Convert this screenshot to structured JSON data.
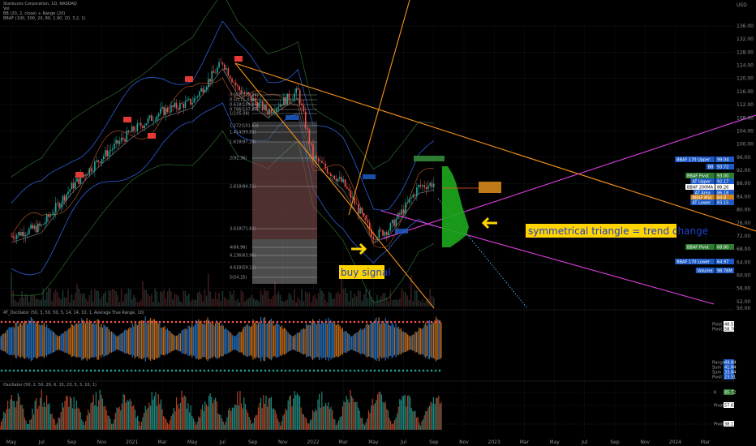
{
  "header": {
    "title": "Starbucks Corporation, 1D, NASDAQ",
    "line2": "Vol",
    "line3": "BB (20, 2, close) + Range (20)",
    "line4": "BBAF (100, 300, 20, 80, 1.90, 20, 3.2, 1)"
  },
  "price_axis": {
    "unit": "USD",
    "ticks": [
      "136.00",
      "132.00",
      "128.00",
      "124.00",
      "120.00",
      "116.00",
      "112.00",
      "108.00",
      "104.00",
      "100.00",
      "96.00",
      "92.00",
      "88.00",
      "84.00",
      "80.00",
      "76.00",
      "72.00",
      "68.00",
      "64.00",
      "60.00",
      "56.00",
      "52.00",
      "50.00"
    ]
  },
  "time_axis": {
    "ticks": [
      "May",
      "Jul",
      "Sep",
      "Nov",
      "2021",
      "Mar",
      "May",
      "Jul",
      "Sep",
      "Nov",
      "2022",
      "Mar",
      "May",
      "Jul",
      "Sep",
      "Nov",
      "2023",
      "Mar",
      "May",
      "Jul",
      "Sep",
      "Nov",
      "2024",
      "Mar"
    ]
  },
  "annotations": {
    "triangle": "symmetrical triangle = trend change",
    "buy": "buy signal"
  },
  "fib_levels": [
    "0.382(112.94)",
    "0.5(111.45)",
    "0.618(109.85)",
    "0.786(107.87)",
    "1(105.08)",
    "1.272(101.63)",
    "1.414(99.83)",
    "1.618(97.24)",
    "2(92.36)",
    "2.618(84.51)",
    "3.618(71.82)",
    "4(66.96)",
    "4.236(63.96)",
    "4.618(59.11)",
    "5(54.25)"
  ],
  "right_labels": {
    "bbaf_upper": "BBAF 170 Upper",
    "bb_upper": "BB Upper",
    "bb": "BB",
    "ema": "EMA",
    "bbaf_pivot": "BBAF Pivot",
    "at_upper": "AT Upper",
    "bbaf_200ma": "BBAF 200MA",
    "at_area": "AT Area",
    "bbaf_mid": "BBAF Mid",
    "at_lower": "AT Lower",
    "bbaf_pivot2": "BBAF Pivot",
    "bbaf_170_lower": "BBAF 170 Lower",
    "volume": "Volume",
    "at_value": "99.04",
    "bb_value": "93.72",
    "bb_val2": "93.00",
    "pivot_val": "92.17",
    "ma_val": "88.26",
    "area_val": "86.18",
    "mid_val": "84.8",
    "lower_val": "83.15",
    "pivot2_val": "68.80",
    "low_val": "64.97",
    "vol_val": "98.76M"
  },
  "panel2": {
    "title": "AT_Oscillator (50, 3, 50, 50, 5, 14, 14, 10, 1, Average True Range, 10)",
    "labels": [
      "Pivot",
      "Pivot",
      "Range",
      "Sum",
      "Sum",
      "Pivot"
    ],
    "values": [
      "48.51",
      "58.70",
      "49.84",
      "41.84",
      "33.84",
      "23.51"
    ]
  },
  "panel3": {
    "title": "Oscillator (50, 2, 50, 20, 6, 15, 23, 5, 3, 10, 1)",
    "values": [
      "85.72",
      "57.62",
      "38.13"
    ],
    "labels": [
      "K",
      "Pivot",
      "Pivot"
    ],
    "ticks": [
      "80.00",
      "40.00",
      "20.00"
    ]
  },
  "colors": {
    "orange": "#f7931a",
    "magenta": "#e040e0",
    "annotation_yellow": "#ffd400",
    "green_candle": "#26a69a",
    "red_candle": "#ef5350"
  },
  "chart_data": {
    "type": "candlestick",
    "title": "Starbucks Corporation, 1D, NASDAQ",
    "x_start": "2020-05",
    "x_end": "2022-09",
    "ylim": [
      50,
      138
    ],
    "key_points": [
      {
        "date": "2020-05",
        "price": 72
      },
      {
        "date": "2020-07",
        "price": 75
      },
      {
        "date": "2020-09",
        "price": 87
      },
      {
        "date": "2020-11",
        "price": 96
      },
      {
        "date": "2021-01",
        "price": 104
      },
      {
        "date": "2021-03",
        "price": 110
      },
      {
        "date": "2021-05",
        "price": 113
      },
      {
        "date": "2021-07",
        "price": 125
      },
      {
        "date": "2021-08",
        "price": 117
      },
      {
        "date": "2021-10",
        "price": 110
      },
      {
        "date": "2021-12",
        "price": 116
      },
      {
        "date": "2022-01",
        "price": 96
      },
      {
        "date": "2022-03",
        "price": 88
      },
      {
        "date": "2022-04",
        "price": 80
      },
      {
        "date": "2022-05",
        "price": 72
      },
      {
        "date": "2022-06",
        "price": 74
      },
      {
        "date": "2022-07",
        "price": 80
      },
      {
        "date": "2022-08",
        "price": 87
      },
      {
        "date": "2022-09",
        "price": 88
      }
    ]
  }
}
